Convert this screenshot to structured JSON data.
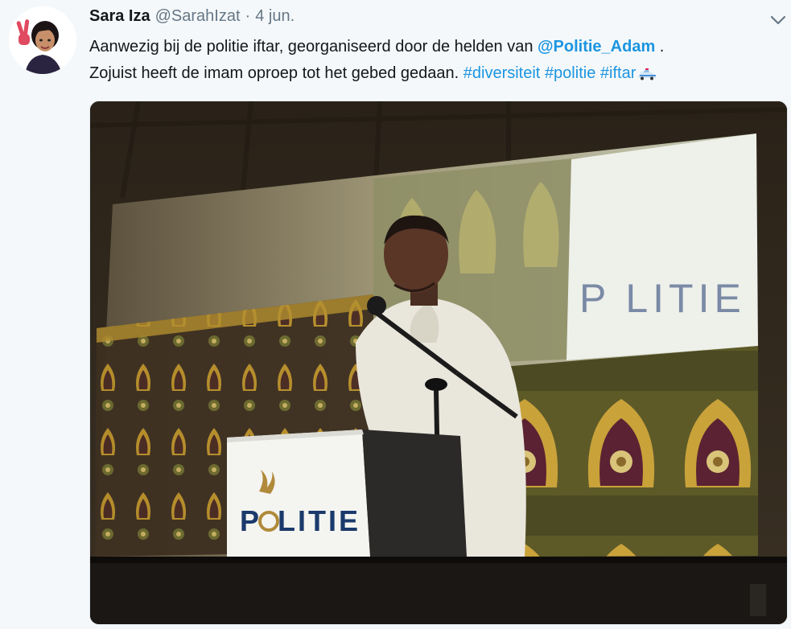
{
  "tweet": {
    "author_name": "Sara Iza",
    "handle": "@SarahIzat",
    "separator": "·",
    "date": "4 jun.",
    "text_line1": "Aanwezig bij de politie iftar, georganiseerd door de helden van ",
    "mention": "@Politie_Adam",
    "text_line1_end": " .",
    "text_line2": "Zojuist heeft de imam oproep tot het gebed gedaan. ",
    "hashtags": [
      "#diversiteit",
      "#politie",
      "#iftar"
    ]
  },
  "media": {
    "logo_text_left": "P",
    "logo_text_right": "LITIE",
    "screen_logo_text_left": "P",
    "screen_logo_text_right": "LITIE"
  },
  "icons": {
    "avatar": "bitmoji-peace-sign-avatar",
    "more": "chevron-down-icon",
    "emoji": "police-car-emoji"
  },
  "colors": {
    "link": "#1b95e0",
    "meta": "#657786",
    "text": "#14171a",
    "background": "#f5f8fa"
  }
}
